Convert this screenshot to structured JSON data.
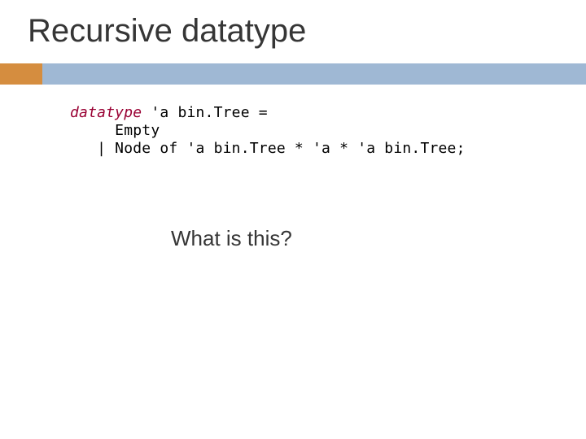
{
  "title": "Recursive datatype",
  "code": {
    "line1_kw": "datatype",
    "line1_rest": " 'a bin.Tree =",
    "line2": "     Empty",
    "line3_before": "   | Node ",
    "line3_of": "of",
    "line3_after": " 'a bin.Tree * 'a * 'a bin.Tree;"
  },
  "question": "What is this?"
}
